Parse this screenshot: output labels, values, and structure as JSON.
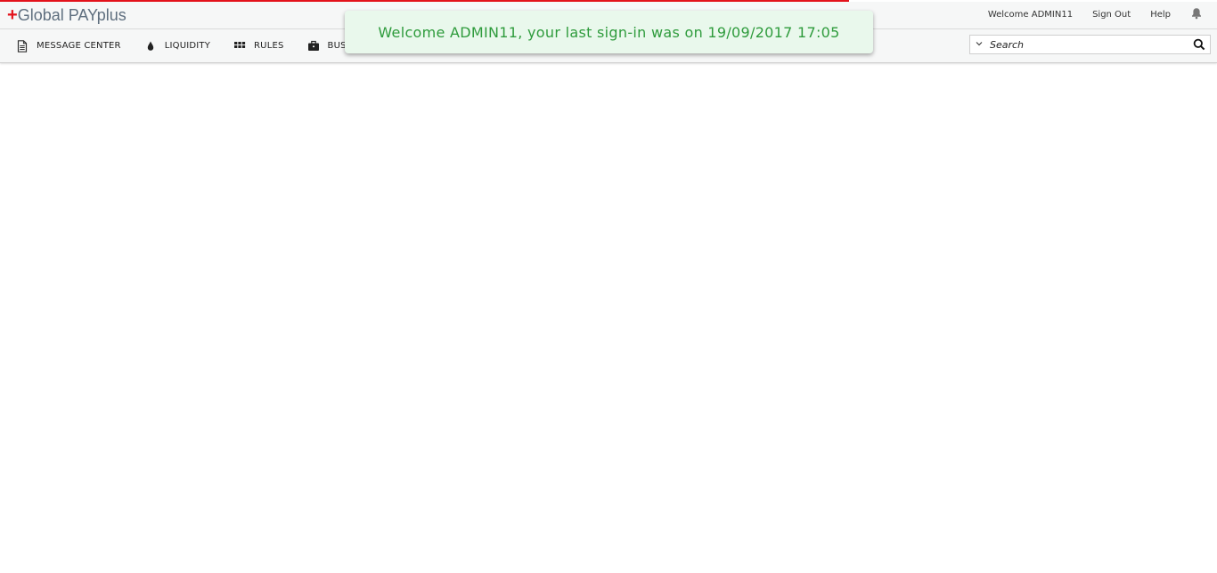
{
  "app": {
    "logo_plus": "+",
    "logo_text": "Global PAYplus"
  },
  "header": {
    "welcome": "Welcome ADMIN11",
    "sign_out": "Sign Out",
    "help": "Help",
    "notification_icon": "bell-icon"
  },
  "nav": {
    "items": [
      {
        "label": "MESSAGE CENTER",
        "icon": "document-icon"
      },
      {
        "label": "LIQUIDITY",
        "icon": "drop-icon"
      },
      {
        "label": "RULES",
        "icon": "grid-icon"
      },
      {
        "label": "BUS",
        "icon": "briefcase-icon"
      }
    ]
  },
  "search": {
    "placeholder": "Search",
    "value": ""
  },
  "toast": {
    "message": "Welcome ADMIN11, your last sign-in was on 19/09/2017 17:05"
  },
  "colors": {
    "accent_red": "#e3121b",
    "toast_bg": "#e9f8ec",
    "toast_text": "#2e9b3c",
    "bar_bg": "#f6f7f7"
  }
}
